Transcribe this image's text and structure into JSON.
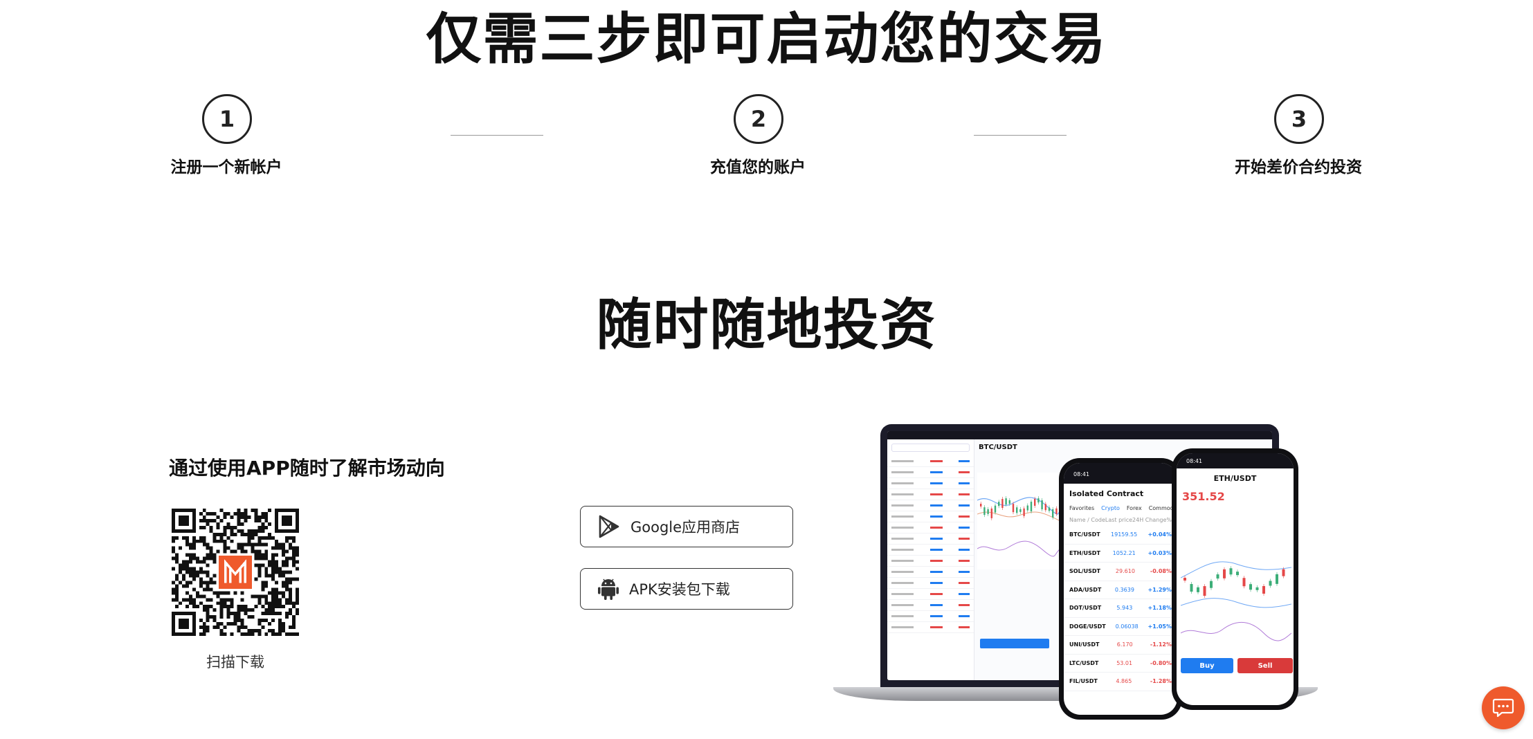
{
  "steps_section": {
    "title": "仅需三步即可启动您的交易",
    "steps": [
      {
        "number": "1",
        "label": "注册一个新帐户"
      },
      {
        "number": "2",
        "label": "充值您的账户"
      },
      {
        "number": "3",
        "label": "开始差价合约投资"
      }
    ]
  },
  "invest_section": {
    "title": "随时随地投资",
    "subtitle": "通过使用APP随时了解市场动向",
    "qr_caption": "扫描下载",
    "google_button": "Google应用商店",
    "apk_button": "APK安装包下载"
  },
  "mockup": {
    "laptop_pair": "BTC/USDT",
    "phone1": {
      "time": "08:41",
      "title": "Isolated Contract",
      "tabs": [
        "Favorites",
        "Crypto",
        "Forex",
        "Commodity"
      ],
      "columns": [
        "Name / Code",
        "Last price",
        "24H Change%"
      ],
      "rows": [
        {
          "pair": "BTC/USDT",
          "price": "19159.55",
          "change": "+0.04%"
        },
        {
          "pair": "ETH/USDT",
          "price": "1052.21",
          "change": "+0.03%"
        },
        {
          "pair": "SOL/USDT",
          "price": "29.610",
          "change": "-0.08%"
        },
        {
          "pair": "ADA/USDT",
          "price": "0.3639",
          "change": "+1.29%"
        },
        {
          "pair": "DOT/USDT",
          "price": "5.943",
          "change": "+1.18%"
        },
        {
          "pair": "DOGE/USDT",
          "price": "0.06038",
          "change": "+1.05%"
        },
        {
          "pair": "UNI/USDT",
          "price": "6.170",
          "change": "-1.12%"
        },
        {
          "pair": "LTC/USDT",
          "price": "53.01",
          "change": "-0.80%"
        },
        {
          "pair": "FIL/USDT",
          "price": "4.865",
          "change": "-1.28%"
        }
      ]
    },
    "phone2": {
      "time": "08:41",
      "pair": "ETH/USDT",
      "price": "351.52",
      "buy": "Buy",
      "sell": "Sell"
    }
  },
  "colors": {
    "accent": "#ef5a2c",
    "up": "#1f7cf0",
    "down": "#e54848",
    "buy": "#1f7cf0",
    "sell": "#d93a3a"
  },
  "icons": {
    "chat": "chat-bubble-icon",
    "google": "google-play-icon",
    "apk": "android-icon"
  }
}
